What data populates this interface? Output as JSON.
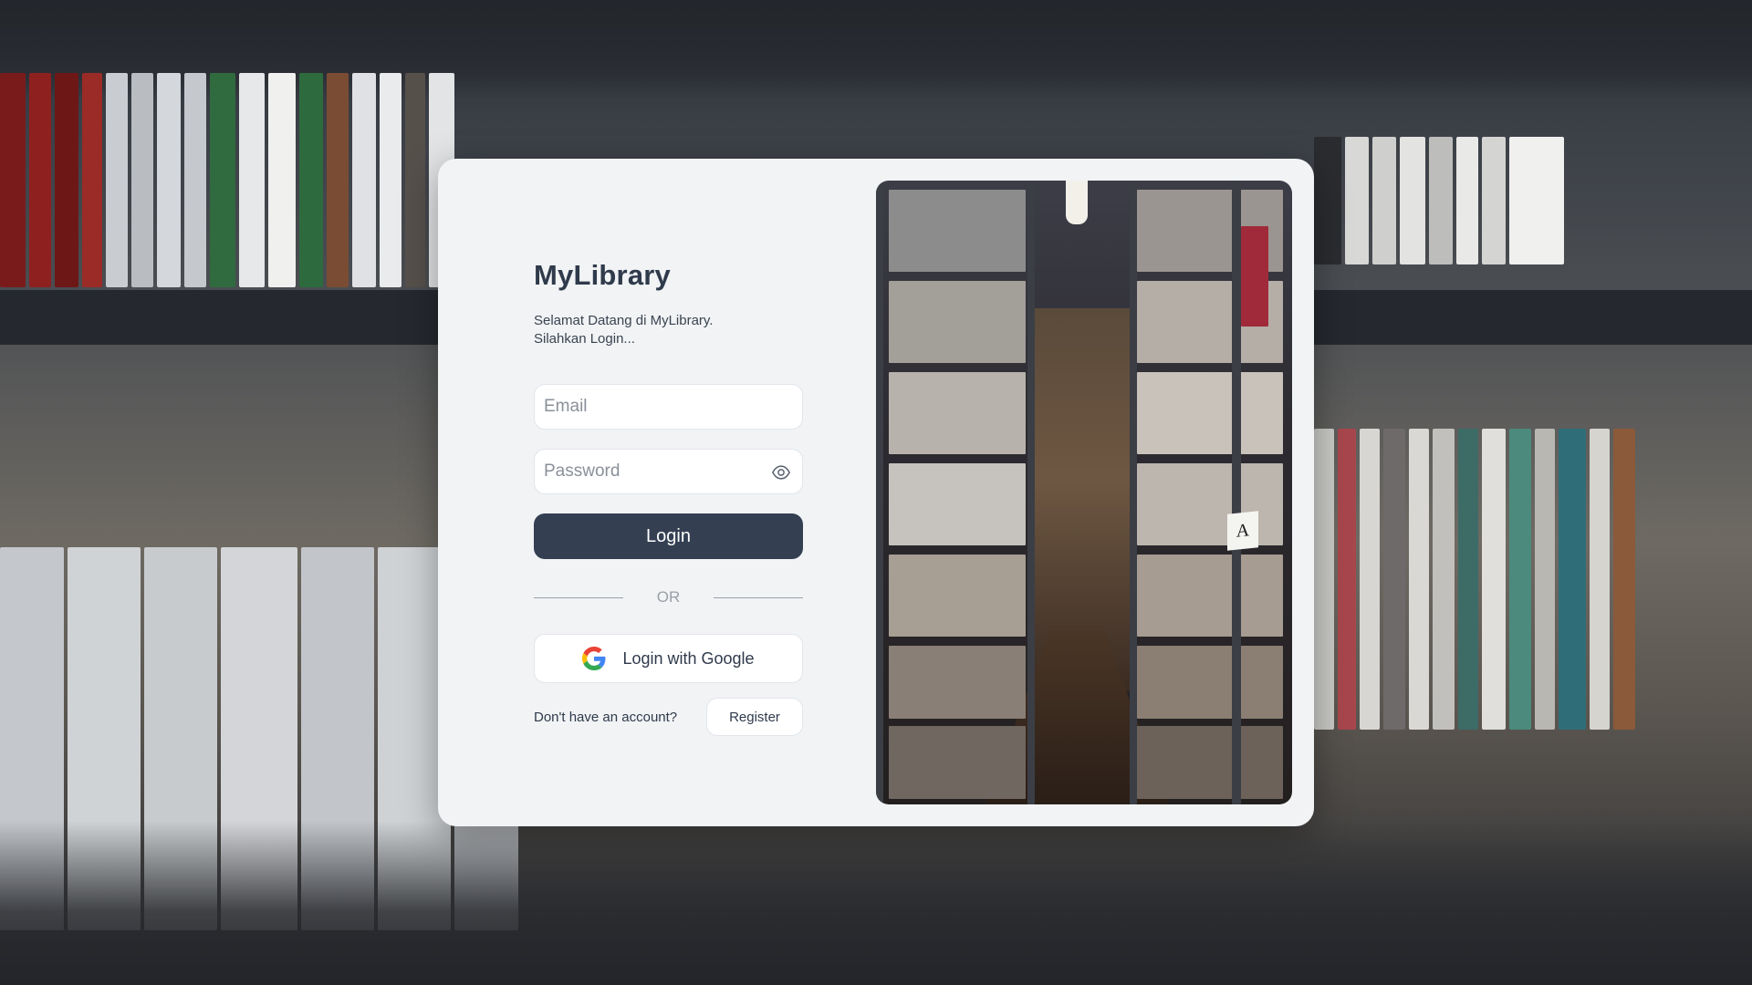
{
  "app": {
    "title": "MyLibrary",
    "subtitle_line1": "Selamat Datang di MyLibrary.",
    "subtitle_line2": "Silahkan Login..."
  },
  "form": {
    "email_placeholder": "Email",
    "password_placeholder": "Password",
    "password_toggle_icon": "eye-icon",
    "login_label": "Login",
    "divider_text": "OR",
    "google_label": "Login with Google",
    "google_icon": "google-logo-icon",
    "account_question": "Don't have an account?",
    "register_label": "Register"
  },
  "image": {
    "shelf_label": "A"
  },
  "colors": {
    "card_background": "#f1f3f5",
    "primary_button": "#343f52",
    "text_dark": "#2f3a4b",
    "muted": "#9aa0a8"
  }
}
